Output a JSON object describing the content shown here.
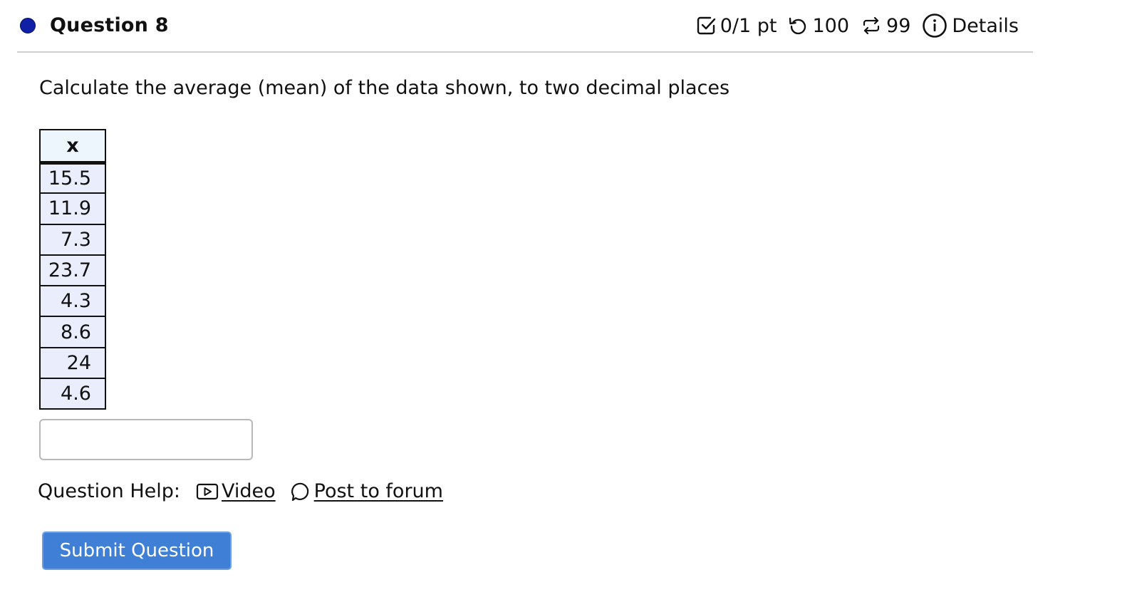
{
  "header": {
    "title": "Question 8",
    "score": "0/1 pt",
    "retries": "100",
    "versions": "99",
    "details_label": "Details"
  },
  "question": {
    "prompt": "Calculate the average (mean) of the data shown, to two decimal places"
  },
  "table": {
    "header": "x",
    "values": [
      "15.5",
      "11.9",
      "7.3",
      "23.7",
      "4.3",
      "8.6",
      "24",
      "4.6"
    ]
  },
  "answer": {
    "value": ""
  },
  "help": {
    "label": "Question Help:",
    "video_label": "Video",
    "forum_label": "Post to forum"
  },
  "submit": {
    "label": "Submit Question"
  },
  "colors": {
    "status_dot": "#0f1fa6",
    "submit_bg": "#3f7fd6",
    "table_header_bg": "#eef6fd",
    "table_cell_bg": "#eaeefc"
  },
  "icons": {
    "score": "checkbox-icon",
    "retries": "undo-icon",
    "versions": "repeat-icon",
    "details": "info-icon",
    "video": "video-icon",
    "forum": "comment-icon"
  }
}
